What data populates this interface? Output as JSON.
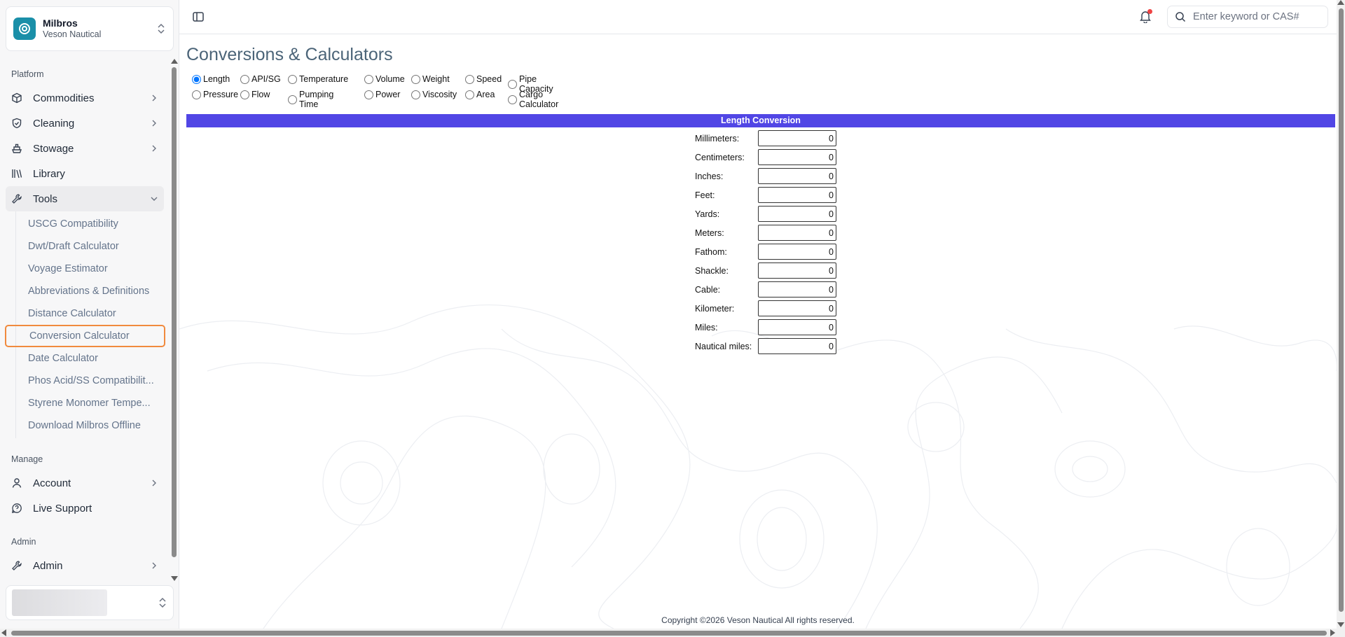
{
  "brand": {
    "name": "Milbros",
    "org": "Veson Nautical"
  },
  "sidebar": {
    "platform_label": "Platform",
    "platform_items": [
      {
        "label": "Commodities",
        "icon": "box-icon"
      },
      {
        "label": "Cleaning",
        "icon": "shield-icon"
      },
      {
        "label": "Stowage",
        "icon": "ship-icon"
      },
      {
        "label": "Library",
        "icon": "library-icon"
      },
      {
        "label": "Tools",
        "icon": "wrench-icon"
      }
    ],
    "tools_sub": [
      "USCG Compatibility",
      "Dwt/Draft Calculator",
      "Voyage Estimator",
      "Abbreviations & Definitions",
      "Distance Calculator",
      "Conversion Calculator",
      "Date Calculator",
      "Phos Acid/SS Compatibilit...",
      "Styrene Monomer Tempe...",
      "Download Milbros Offline"
    ],
    "manage_label": "Manage",
    "manage_items": [
      {
        "label": "Account",
        "icon": "user-icon"
      },
      {
        "label": "Live Support",
        "icon": "support-icon"
      }
    ],
    "admin_label": "Admin",
    "admin_items": [
      {
        "label": "Admin",
        "icon": "wrench-icon"
      }
    ]
  },
  "search": {
    "placeholder": "Enter keyword or CAS#"
  },
  "main": {
    "title": "Conversions & Calculators",
    "radio_row1": [
      "Length",
      "API/SG",
      "Temperature",
      "Volume",
      "Weight",
      "Speed",
      "Pipe Capacity"
    ],
    "radio_row2": [
      "Pressure",
      "Flow",
      "Pumping Time",
      "Power",
      "Viscosity",
      "Area",
      "Cargo Calculator"
    ],
    "selected": "Length",
    "conversion_title": "Length Conversion",
    "fields": [
      {
        "label": "Millimeters:",
        "value": "0"
      },
      {
        "label": "Centimeters:",
        "value": "0"
      },
      {
        "label": "Inches:",
        "value": "0"
      },
      {
        "label": "Feet:",
        "value": "0"
      },
      {
        "label": "Yards:",
        "value": "0"
      },
      {
        "label": "Meters:",
        "value": "0"
      },
      {
        "label": "Fathom:",
        "value": "0"
      },
      {
        "label": "Shackle:",
        "value": "0"
      },
      {
        "label": "Cable:",
        "value": "0"
      },
      {
        "label": "Kilometer:",
        "value": "0"
      },
      {
        "label": "Miles:",
        "value": "0"
      },
      {
        "label": "Nautical miles:",
        "value": "0"
      }
    ],
    "footer": "Copyright ©2026 Veson Nautical All rights reserved."
  },
  "colors": {
    "accent": "#5146e5",
    "active_outline": "#f08a3e",
    "brand": "#1a8fa8",
    "title": "#4b6478"
  }
}
